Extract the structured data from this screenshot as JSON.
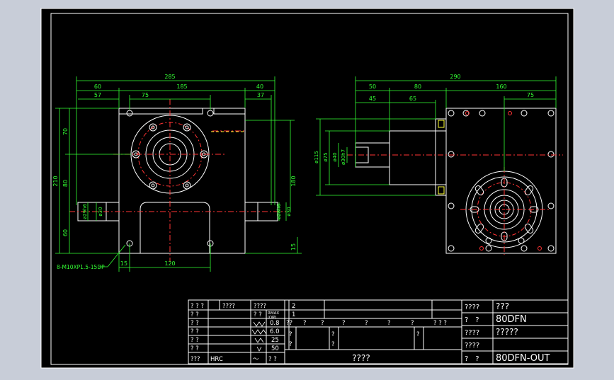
{
  "colors": {
    "window_bg": "#c8cdd8",
    "sheet_bg": "#000000",
    "border": "#ffffff",
    "part": "#ffffff",
    "dimension": "#33ff33",
    "center_line": "#ff3333",
    "hidden_detail": "#ffff33",
    "label_cyan": "#33ffff"
  },
  "front_view": {
    "dims": {
      "overall_width": "285",
      "left_offset": "60",
      "body_width": "185",
      "right_offset": "40",
      "flange_left": "57",
      "bolt_span": "75",
      "right_step": "37",
      "total_height": "210",
      "upper_height": "70",
      "middle_height": "80",
      "lower_height": "60",
      "shaft_center_height": "180",
      "base_height": "15",
      "base_left": "15",
      "base_width": "120"
    },
    "shaft_labels": {
      "left_fit": "ø29h6",
      "left_dia": "ø30",
      "right_fit": "ø28h6",
      "right_dia": "ø30"
    },
    "bolt_note": "8-M10XP1.5-15DP"
  },
  "side_view": {
    "dims": {
      "overall_length": "290",
      "hub_offset": "50",
      "motor_length": "80",
      "body_length": "160",
      "hub_length": "45",
      "shaft_length": "65",
      "bolt_circle": "75",
      "flange_dia": "ø115",
      "pilot_dia": "ø75",
      "hub_dia": "ø40",
      "shaft_dia": "ø30h7"
    }
  },
  "title_block": {
    "left_rows": [
      {
        "label": "? ? ?",
        "val": "????",
        "sub": "????"
      },
      {
        "label": "? ?",
        "val": "",
        "sub": "? ?"
      },
      {
        "label": "? ?",
        "val": "0.8"
      },
      {
        "label": "? ?",
        "val": "6.0"
      },
      {
        "label": "? ?",
        "val": "25"
      },
      {
        "label": "? ?",
        "val": "50"
      },
      {
        "label": "???",
        "val": "HRC"
      }
    ],
    "roughness_header": "RMAX",
    "roughness_sub": "(OIP)",
    "tilde": "～",
    "bottom_tilde_val": "? ?",
    "mid_rows": [
      "2",
      "1"
    ],
    "mid_header": [
      "??",
      "?",
      "?",
      "?",
      "?",
      "?",
      "?",
      "? ? ?"
    ],
    "mid_cells": [
      "?",
      "?",
      "?",
      "?",
      "?"
    ],
    "bottom_center": "????",
    "right_rows": [
      {
        "label": "????",
        "value": "???"
      },
      {
        "label": "?　?",
        "value": "80DFN"
      },
      {
        "label": "????",
        "value": "?????"
      },
      {
        "label": "????",
        "value": ""
      },
      {
        "label": "?　?",
        "value": "80DFN-OUT"
      }
    ]
  }
}
